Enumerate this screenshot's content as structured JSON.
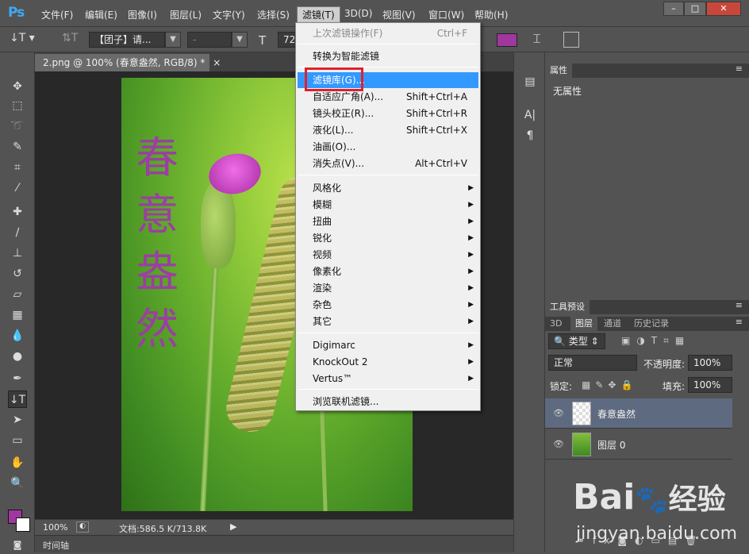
{
  "menubar": {
    "logo": "Ps",
    "items": [
      "文件(F)",
      "编辑(E)",
      "图像(I)",
      "图层(L)",
      "文字(Y)",
      "选择(S)",
      "滤镜(T)",
      "3D(D)",
      "视图(V)",
      "窗口(W)",
      "帮助(H)"
    ],
    "active_index": 6,
    "window_controls": [
      "–",
      "□",
      "✕"
    ]
  },
  "options_bar": {
    "tool_icon": "vertical-type-icon",
    "font_family": "【团子】请...",
    "font_style": "-",
    "font_size": "72",
    "color_swatch": "#a0379f"
  },
  "document": {
    "tab_title": "2.png @ 100% (春意盎然, RGB/8) *",
    "tab_close": "×",
    "canvas_text": [
      "春",
      "意",
      "盎",
      "然"
    ],
    "text_color": "#9b3fa2"
  },
  "statusbar": {
    "zoom": "100%",
    "doc_info": "文档:586.5 K/713.8K",
    "timeline_label": "时间轴"
  },
  "filter_menu": {
    "items": [
      {
        "label": "上次滤镜操作(F)",
        "shortcut": "Ctrl+F",
        "disabled": true
      },
      {
        "label": "转换为智能滤镜"
      },
      {
        "label": "滤镜库(G)...",
        "highlighted": true
      },
      {
        "label": "自适应广角(A)...",
        "shortcut": "Shift+Ctrl+A"
      },
      {
        "label": "镜头校正(R)...",
        "shortcut": "Shift+Ctrl+R"
      },
      {
        "label": "液化(L)...",
        "shortcut": "Shift+Ctrl+X"
      },
      {
        "label": "油画(O)..."
      },
      {
        "label": "消失点(V)...",
        "shortcut": "Alt+Ctrl+V"
      },
      {
        "label": "风格化",
        "submenu": true
      },
      {
        "label": "模糊",
        "submenu": true
      },
      {
        "label": "扭曲",
        "submenu": true
      },
      {
        "label": "锐化",
        "submenu": true
      },
      {
        "label": "视频",
        "submenu": true
      },
      {
        "label": "像素化",
        "submenu": true
      },
      {
        "label": "渲染",
        "submenu": true
      },
      {
        "label": "杂色",
        "submenu": true
      },
      {
        "label": "其它",
        "submenu": true
      },
      {
        "label": "Digimarc",
        "submenu": true
      },
      {
        "label": "KnockOut 2",
        "submenu": true
      },
      {
        "label": "Vertus™",
        "submenu": true
      },
      {
        "label": "浏览联机滤镜..."
      }
    ]
  },
  "properties_panel": {
    "title": "属性",
    "content": "无属性"
  },
  "tool_presets_panel": {
    "title": "工具预设"
  },
  "layers_panel": {
    "tabs": [
      "3D",
      "图层",
      "通道",
      "历史记录"
    ],
    "active_tab": 1,
    "filter_kind": "类型",
    "blend_mode": "正常",
    "opacity_label": "不透明度:",
    "opacity": "100%",
    "lock_label": "锁定:",
    "fill_label": "填充:",
    "fill": "100%",
    "layers": [
      {
        "name": "春意盎然",
        "selected": true
      },
      {
        "name": "图层 0",
        "selected": false
      }
    ]
  },
  "watermark": {
    "brand": "Bai",
    "brand_suffix": "经验",
    "url": "jingyan.baidu.com"
  }
}
